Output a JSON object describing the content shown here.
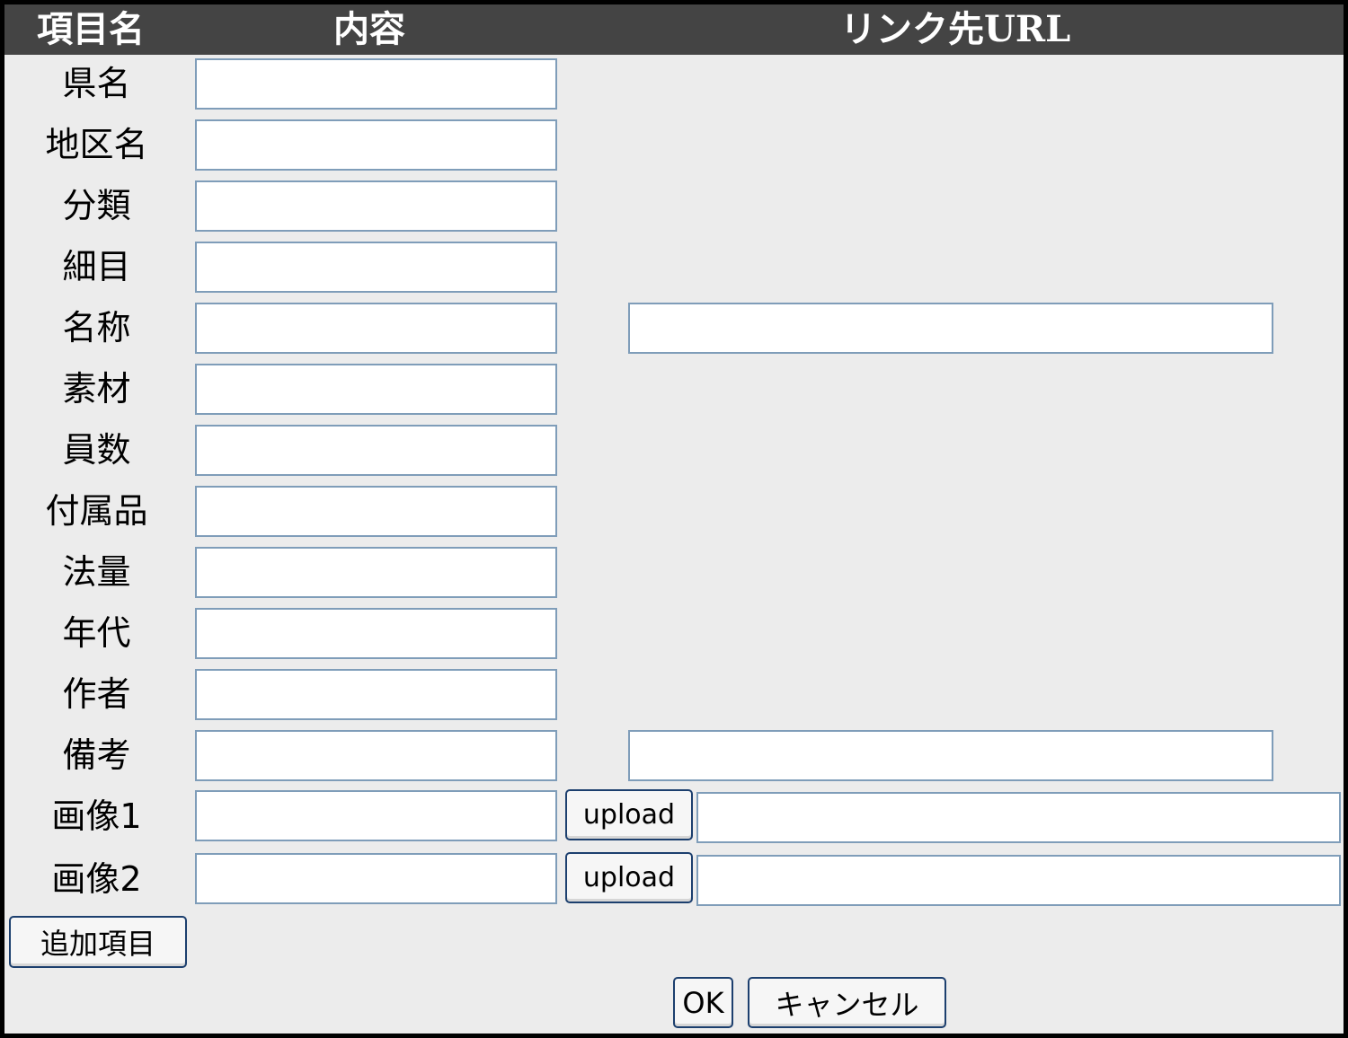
{
  "header": {
    "col_item": "項目名",
    "col_content": "内容",
    "col_link": "リンク先URL"
  },
  "rows": [
    {
      "label": "県名",
      "content": "",
      "has_link": false
    },
    {
      "label": "地区名",
      "content": "",
      "has_link": false
    },
    {
      "label": "分類",
      "content": "",
      "has_link": false
    },
    {
      "label": "細目",
      "content": "",
      "has_link": false
    },
    {
      "label": "名称",
      "content": "",
      "has_link": true,
      "link": ""
    },
    {
      "label": "素材",
      "content": "",
      "has_link": false
    },
    {
      "label": "員数",
      "content": "",
      "has_link": false
    },
    {
      "label": "付属品",
      "content": "",
      "has_link": false
    },
    {
      "label": "法量",
      "content": "",
      "has_link": false
    },
    {
      "label": "年代",
      "content": "",
      "has_link": false
    },
    {
      "label": "作者",
      "content": "",
      "has_link": false
    },
    {
      "label": "備考",
      "content": "",
      "has_link": true,
      "link": ""
    }
  ],
  "images": [
    {
      "label": "画像1",
      "content": "",
      "upload_label": "upload",
      "link": ""
    },
    {
      "label": "画像2",
      "content": "",
      "upload_label": "upload",
      "link": ""
    }
  ],
  "buttons": {
    "add_item": "追加項目",
    "ok": "OK",
    "cancel": "キャンセル"
  }
}
